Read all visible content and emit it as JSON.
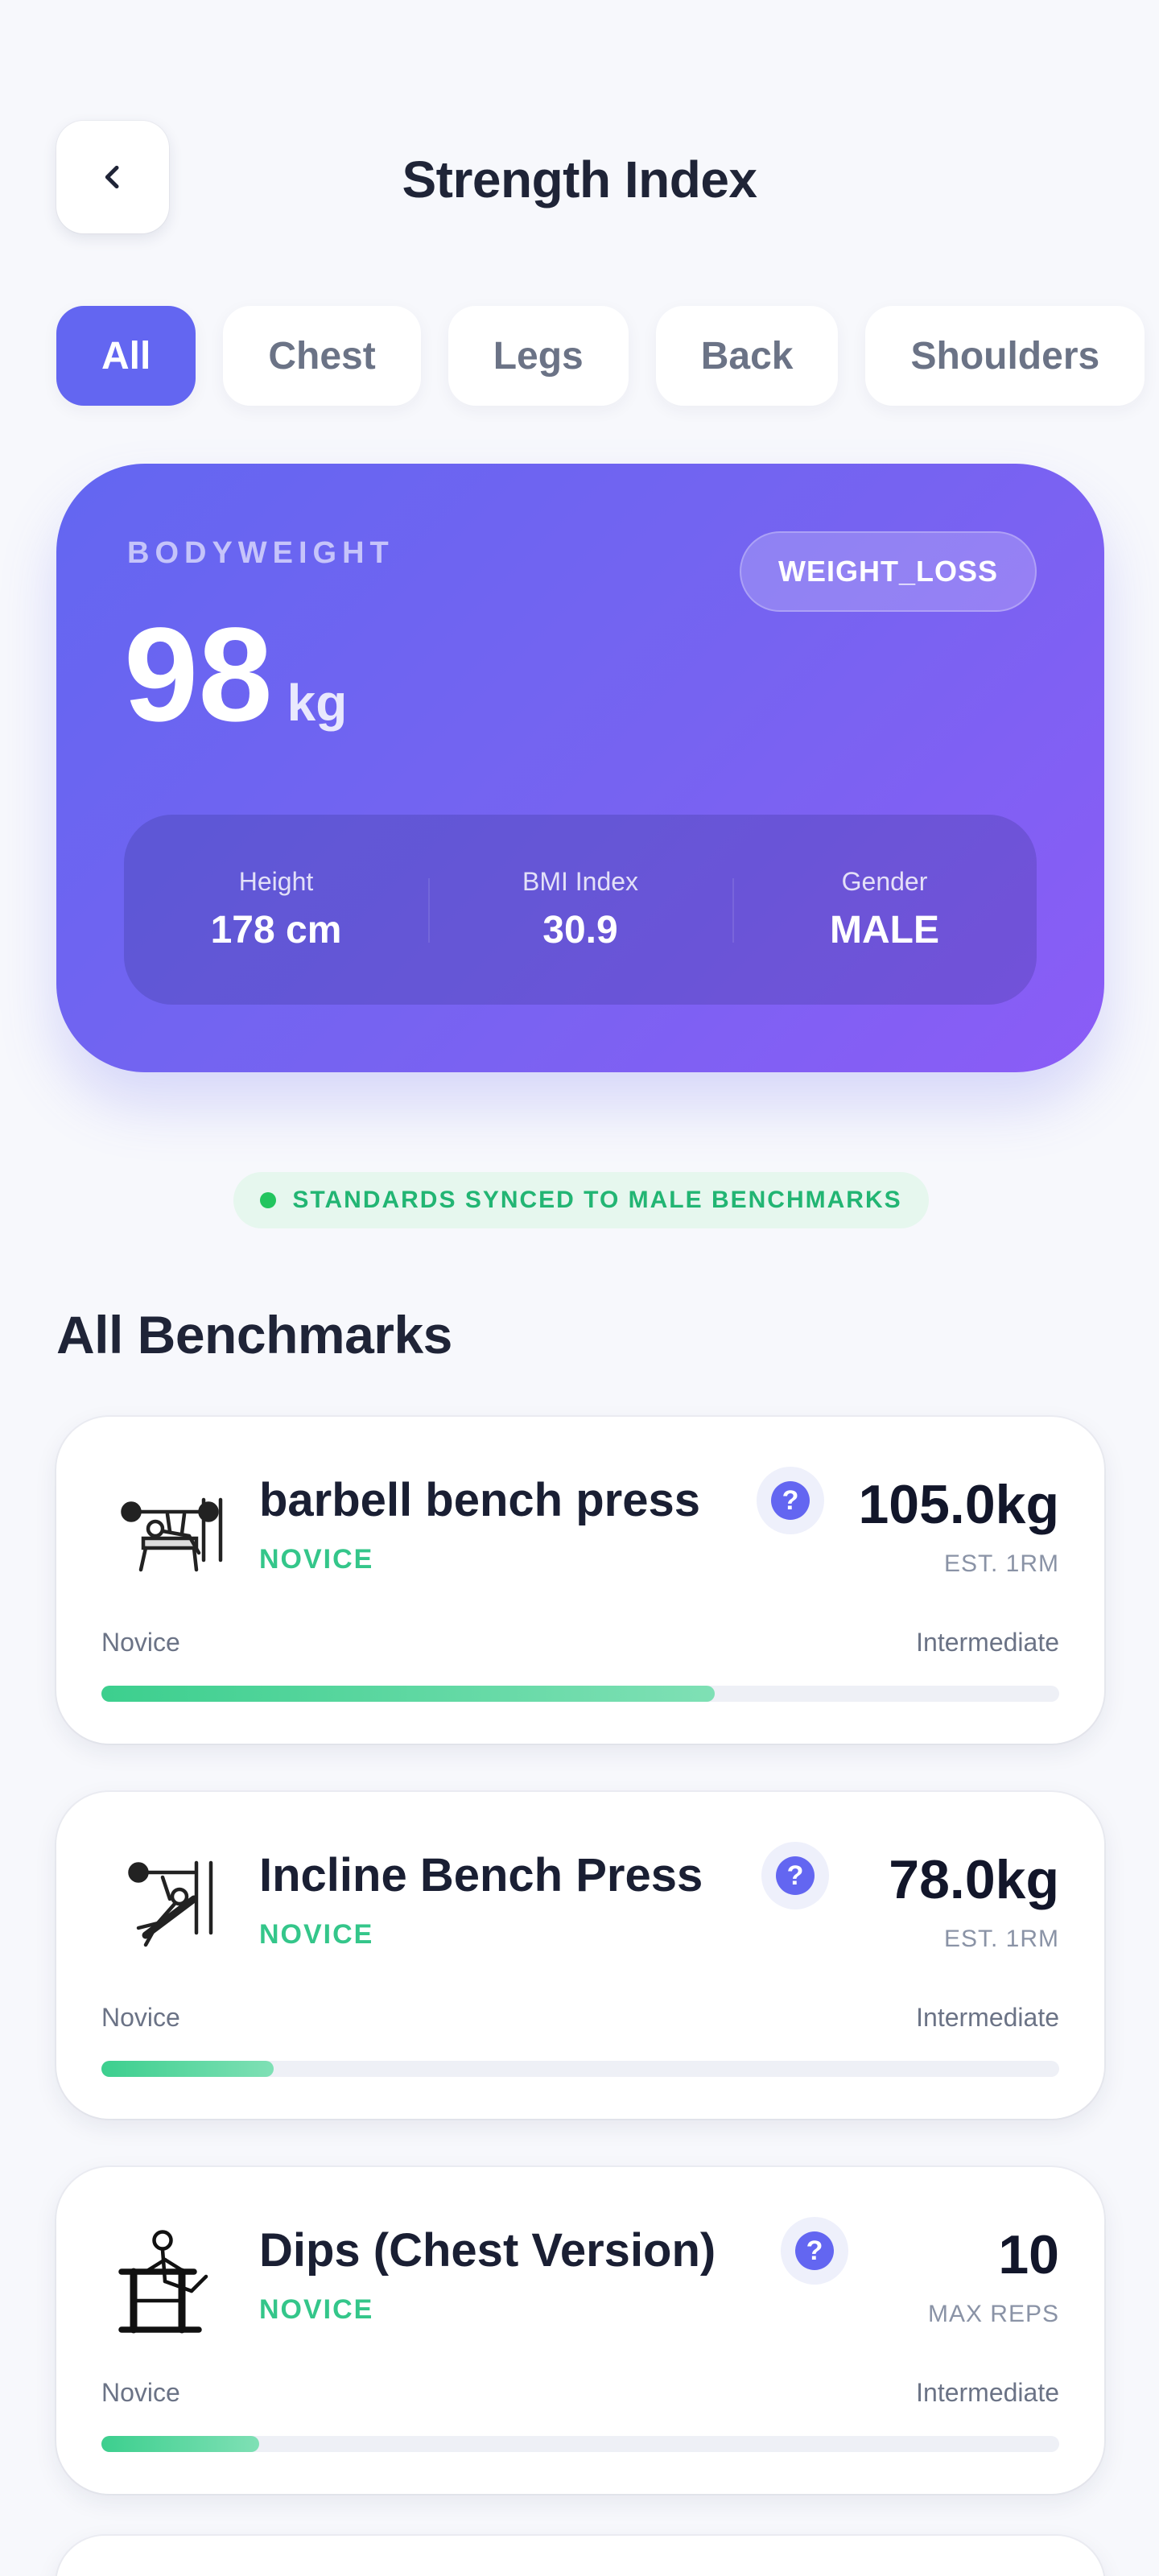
{
  "header": {
    "title": "Strength Index"
  },
  "tabs": [
    {
      "label": "All",
      "active": true
    },
    {
      "label": "Chest",
      "active": false
    },
    {
      "label": "Legs",
      "active": false
    },
    {
      "label": "Back",
      "active": false
    },
    {
      "label": "Shoulders",
      "active": false
    }
  ],
  "hero": {
    "label": "BODYWEIGHT",
    "weight": "98",
    "unit": "kg",
    "goal": "WEIGHT_LOSS",
    "stats": [
      {
        "label": "Height",
        "value": "178 cm"
      },
      {
        "label": "BMI Index",
        "value": "30.9"
      },
      {
        "label": "Gender",
        "value": "MALE"
      }
    ]
  },
  "sync_status": "STANDARDS SYNCED TO MALE BENCHMARKS",
  "section_title": "All Benchmarks",
  "benchmarks": [
    {
      "name": "barbell bench press",
      "level": "NOVICE",
      "value": "105.0kg",
      "value_label": "EST. 1RM",
      "range_from": "Novice",
      "range_to": "Intermediate",
      "progress": 0.64,
      "icon": "bench-press-icon"
    },
    {
      "name": "Incline Bench Press",
      "level": "NOVICE",
      "value": "78.0kg",
      "value_label": "EST. 1RM",
      "range_from": "Novice",
      "range_to": "Intermediate",
      "progress": 0.18,
      "icon": "incline-press-icon"
    },
    {
      "name": "Dips (Chest Version)",
      "level": "NOVICE",
      "value": "10",
      "value_label": "MAX REPS",
      "range_from": "Novice",
      "range_to": "Intermediate",
      "progress": 0.165,
      "icon": "dips-icon"
    }
  ],
  "colors": {
    "accent": "#6366f1",
    "accent_end": "#8b5cf6",
    "success": "#34c68a",
    "text_dark": "#1f2437"
  }
}
